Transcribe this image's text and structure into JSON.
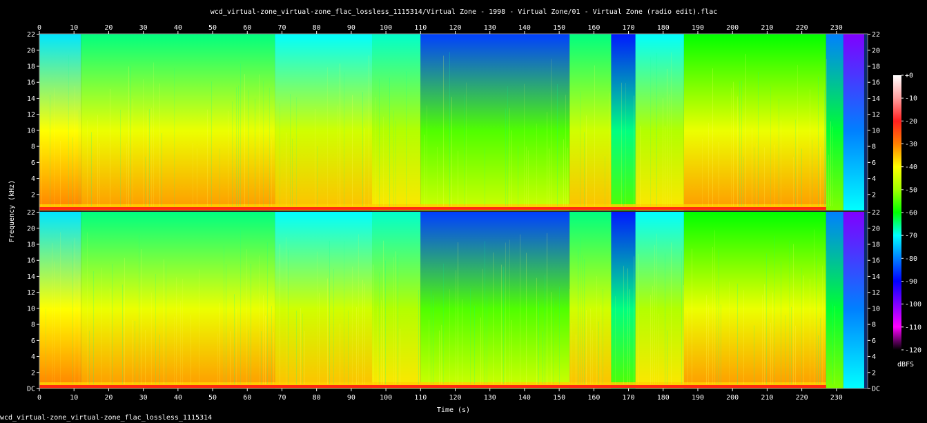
{
  "title": "wcd_virtual-zone_virtual-zone_flac_lossless_1115314/Virtual Zone - 1998 - Virtual Zone/01 - Virtual Zone (radio edit).flac",
  "footer_text": "wcd_virtual-zone_virtual-zone_flac_lossless_1115314",
  "chart_data": {
    "type": "heatmap",
    "subtype": "spectrogram",
    "title": "wcd_virtual-zone_virtual-zone_flac_lossless_1115314/Virtual Zone - 1998 - Virtual Zone/01 - Virtual Zone (radio edit).flac",
    "xlabel": "Time (s)",
    "ylabel": "Frequency (kHz)",
    "xlim": [
      0,
      239
    ],
    "ylim": [
      0,
      22.05
    ],
    "x_ticks": [
      "0",
      "10",
      "20",
      "30",
      "40",
      "50",
      "60",
      "70",
      "80",
      "90",
      "100",
      "110",
      "120",
      "130",
      "140",
      "150",
      "160",
      "170",
      "180",
      "190",
      "200",
      "210",
      "220",
      "230"
    ],
    "y_ticks": [
      "DC",
      "2",
      "4",
      "6",
      "8",
      "10",
      "12",
      "14",
      "16",
      "18",
      "20",
      "22"
    ],
    "channels": 2,
    "colorbar": {
      "label": "dBFS",
      "range": [
        -120,
        0
      ],
      "ticks": [
        "+0",
        "-10",
        "-20",
        "-30",
        "-40",
        "-50",
        "-60",
        "-70",
        "-80",
        "-90",
        "-100",
        "-110",
        "-120"
      ],
      "colors": [
        "#ffffff",
        "#ffa0a0",
        "#ff2020",
        "#ff8000",
        "#ffff00",
        "#a0ff00",
        "#00ff00",
        "#00ffff",
        "#0080ff",
        "#0000ff",
        "#8000ff",
        "#ff00ff",
        "#000000"
      ]
    },
    "segments_db": [
      {
        "t": [
          0,
          12
        ],
        "low": -40,
        "high": -72
      },
      {
        "t": [
          12,
          68
        ],
        "low": -42,
        "high": -65
      },
      {
        "t": [
          68,
          96
        ],
        "low": -45,
        "high": -70
      },
      {
        "t": [
          96,
          110
        ],
        "low": -48,
        "high": -68
      },
      {
        "t": [
          110,
          153
        ],
        "low": -55,
        "high": -85
      },
      {
        "t": [
          153,
          165
        ],
        "low": -45,
        "high": -65
      },
      {
        "t": [
          165,
          172
        ],
        "low": -65,
        "high": -88
      },
      {
        "t": [
          172,
          186
        ],
        "low": -48,
        "high": -70
      },
      {
        "t": [
          186,
          227
        ],
        "low": -42,
        "high": -60
      },
      {
        "t": [
          227,
          232
        ],
        "low": -62,
        "high": -80
      },
      {
        "t": [
          232,
          238
        ],
        "low": -80,
        "high": -100
      }
    ]
  }
}
